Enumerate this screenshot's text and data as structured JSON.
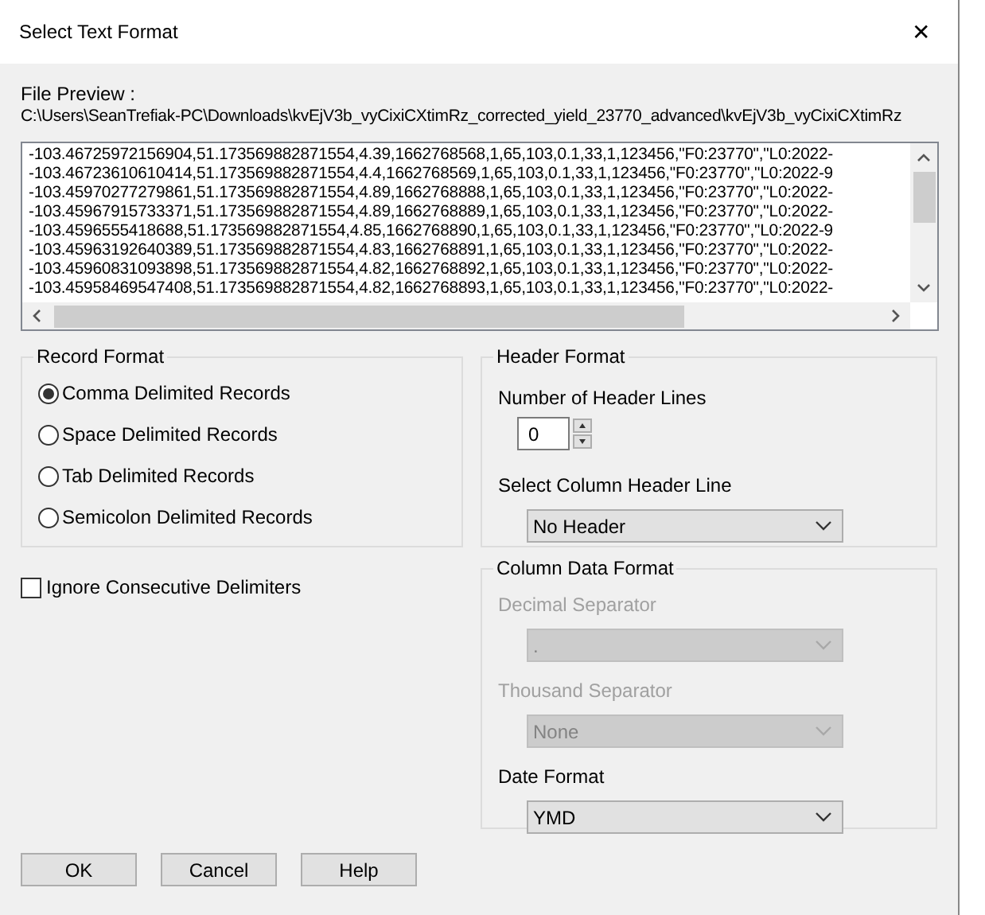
{
  "window": {
    "title": "Select Text Format",
    "close": "✕"
  },
  "file_preview": {
    "label": "File Preview :",
    "path": "C:\\Users\\SeanTrefiak-PC\\Downloads\\kvEjV3b_vyCixiCXtimRz_corrected_yield_23770_advanced\\kvEjV3b_vyCixiCXtimRz",
    "lines": [
      "-103.46725972156904,51.173569882871554,4.39,1662768568,1,65,103,0.1,33,1,123456,\"F0:23770\",\"L0:2022-",
      "-103.467236106104­14,51.173569882871554,4.4,1662768569,1,65,103,0.1,33,1,123456,\"F0:23770\",\"L0:2022-9",
      "-103.4597027727986­1,51.173569882871554,4.89,1662768888,1,65,103,0.1,33,1,123456,\"F0:23770\",\"L0:2022-",
      "-103.45967915733371,51.173569882871554,4.89,1662768889,1,65,103,0.1,33,1,123456,\"F0:23770\",\"L0:2022-",
      "-103.4596555418688,51.173569882871554,4.85,1662768890,1,65,103,0.1,33,1,123456,\"F0:23770\",\"L0:2022-9",
      "-103.45963192640389,51.173569882871554,4.83,1662768891,1,65,103,0.1,33,1,123456,\"F0:23770\",\"L0:2022-",
      "-103.45960831093898,51.173569882871554,4.82,1662768892,1,65,103,0.1,33,1,123456,\"F0:23770\",\"L0:2022-",
      "-103.45958469547408,51.173569882871554,4.82,1662768893,1,65,103,0.1,33,1,123456,\"F0:23770\",\"L0:2022-"
    ]
  },
  "record_format": {
    "title": "Record Format",
    "options": [
      {
        "label": "Comma Delimited Records",
        "selected": true
      },
      {
        "label": "Space Delimited Records",
        "selected": false
      },
      {
        "label": "Tab Delimited Records",
        "selected": false
      },
      {
        "label": "Semicolon Delimited Records",
        "selected": false
      }
    ]
  },
  "ignore_consecutive": {
    "label": "Ignore Consecutive Delimiters",
    "checked": false
  },
  "header_format": {
    "title": "Header Format",
    "lines_label": "Number of Header Lines",
    "lines_value": "0",
    "column_label": "Select Column Header Line",
    "column_value": "No Header"
  },
  "column_data_format": {
    "title": "Column Data Format",
    "fields": [
      {
        "label": "Decimal Separator",
        "value": ".",
        "disabled": true
      },
      {
        "label": "Thousand Separator",
        "value": "None",
        "disabled": true
      },
      {
        "label": "Date Format",
        "value": "YMD",
        "disabled": false
      }
    ]
  },
  "buttons": [
    "OK",
    "Cancel",
    "Help"
  ]
}
